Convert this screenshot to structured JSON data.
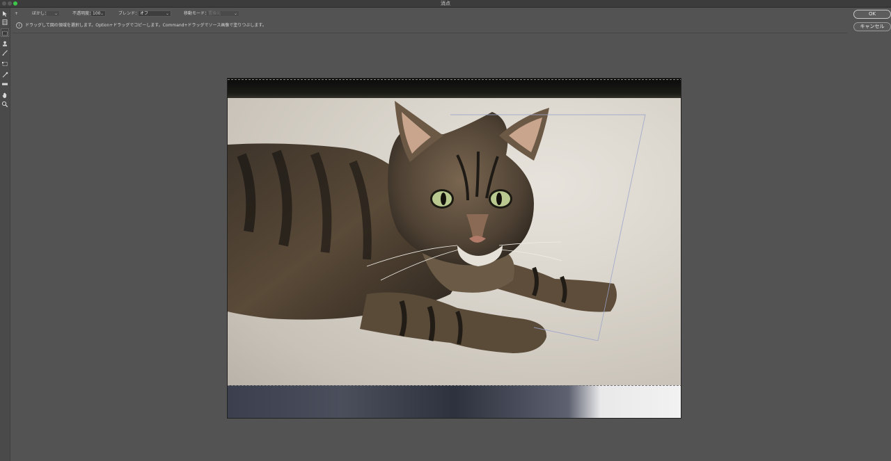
{
  "window": {
    "title": "消点"
  },
  "options_bar": {
    "plus_label": "+",
    "blur_label": "ぼかし：",
    "blur_value": "",
    "opacity_label": "不透明度：",
    "opacity_value": "100",
    "blend_label": "ブレンド：",
    "blend_value": "オフ",
    "move_mode_label": "移動モード：",
    "move_mode_value": "置換元"
  },
  "info": {
    "icon": "info-icon",
    "text": "ドラッグして図の領域を選択します。Option+ドラッグでコピーします。Command+ドラッグでソース画像で塗りつぶします。"
  },
  "tools": [
    "select-arrow-icon",
    "edit-plane-icon",
    "marquee-icon",
    "stamp-icon",
    "brush-icon",
    "transform-icon",
    "eyedropper-icon",
    "measure-icon",
    "hand-icon",
    "zoom-icon"
  ],
  "buttons": {
    "ok": "OK",
    "cancel": "キャンセル"
  },
  "colors": {
    "background": "#535353",
    "toolbar": "#4a4a4a",
    "plane_outline": "#9aa3c9"
  }
}
